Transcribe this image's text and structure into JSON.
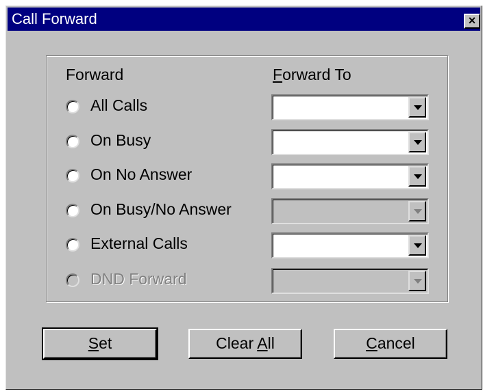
{
  "window": {
    "title": "Call Forward",
    "close_label": "×"
  },
  "group": {
    "header_forward": "Forward",
    "header_forward_to": "Forward To"
  },
  "rows": [
    {
      "label": "All Calls",
      "enabled": true,
      "combo_value": "",
      "combo_enabled": true
    },
    {
      "label": "On Busy",
      "enabled": true,
      "combo_value": "",
      "combo_enabled": true
    },
    {
      "label": "On No Answer",
      "enabled": true,
      "combo_value": "",
      "combo_enabled": true
    },
    {
      "label": "On Busy/No Answer",
      "enabled": true,
      "combo_value": "",
      "combo_enabled": false
    },
    {
      "label": "External Calls",
      "enabled": true,
      "combo_value": "",
      "combo_enabled": true
    },
    {
      "label": "DND Forward",
      "enabled": false,
      "combo_value": "",
      "combo_enabled": false
    }
  ],
  "buttons": {
    "set": {
      "mnemonic": "S",
      "rest": "et"
    },
    "clear_all": {
      "pre": "Clear ",
      "mnemonic": "A",
      "rest": "ll"
    },
    "cancel": {
      "mnemonic": "C",
      "rest": "ancel"
    }
  },
  "colors": {
    "titlebar": "#000080",
    "face": "#c0c0c0",
    "disabled_text": "#808080"
  }
}
